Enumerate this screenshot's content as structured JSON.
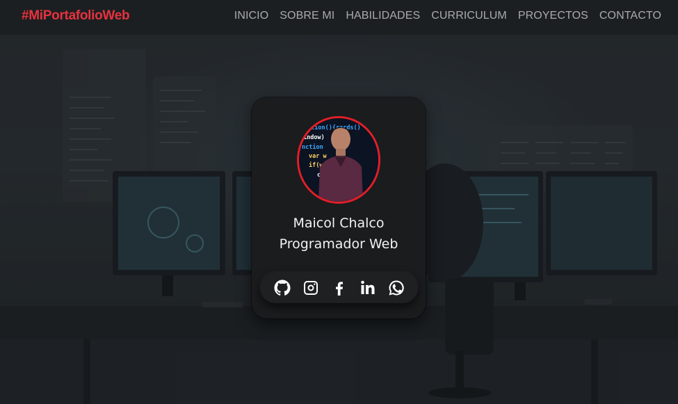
{
  "navbar": {
    "brand": "#MiPortafolioWeb",
    "links": [
      "INICIO",
      "SOBRE MI",
      "HABILIDADES",
      "CURRICULUM",
      "PROYECTOS",
      "CONTACTO"
    ]
  },
  "profile": {
    "name": "Maicol Chalco",
    "role": "Programador Web",
    "photo_code_lines": [
      "ction(){rards()",
      "indow)",
      "nction",
      "var w",
      "if(wi",
      "ca"
    ],
    "social": [
      "github-icon",
      "instagram-icon",
      "facebook-icon",
      "linkedin-icon",
      "whatsapp-icon"
    ]
  },
  "colors": {
    "brand": "#e8323f",
    "nav_text": "#a9abae",
    "card_bg": "#1b1c1e",
    "avatar_border": "#e21f27",
    "text": "#f2f2f2"
  }
}
